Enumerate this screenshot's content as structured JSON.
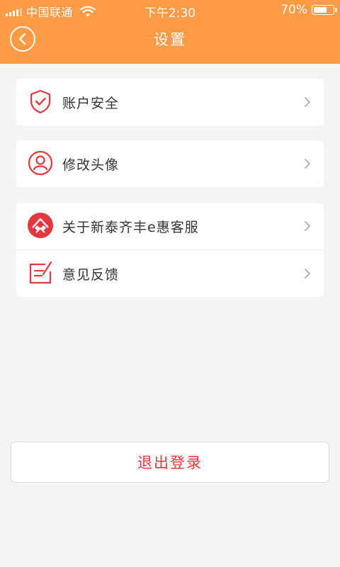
{
  "status_bar": {
    "carrier": "中国联通",
    "time": "下午2:30",
    "battery_percent": "70%",
    "battery_level": 0.7
  },
  "nav": {
    "title": "设置",
    "back_icon": "chevron-left-circle-icon"
  },
  "settings_groups": [
    {
      "items": [
        {
          "label": "账户安全",
          "icon": "shield-check-icon"
        }
      ]
    },
    {
      "items": [
        {
          "label": "修改头像",
          "icon": "user-avatar-icon"
        }
      ]
    },
    {
      "items": [
        {
          "label": "关于新泰齐丰e惠客服",
          "icon": "app-logo-icon"
        },
        {
          "label": "意见反馈",
          "icon": "feedback-edit-icon"
        }
      ]
    }
  ],
  "logout": {
    "label": "退出登录"
  },
  "colors": {
    "header": "#ff9a46",
    "accent_red": "#e2373f",
    "background": "#f4f4f4"
  }
}
